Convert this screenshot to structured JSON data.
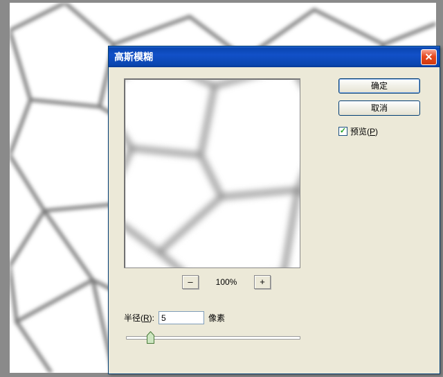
{
  "dialog": {
    "title": "高斯模糊",
    "ok_label": "确定",
    "cancel_label": "取消",
    "preview_label": "预览(",
    "preview_hotkey": "P",
    "preview_suffix": ")",
    "preview_checked": true,
    "zoom": {
      "minus": "–",
      "plus": "+",
      "percent": "100%"
    },
    "radius": {
      "label_prefix": "半径(",
      "hotkey": "R",
      "label_suffix": "):",
      "value": "5",
      "unit": "像素",
      "slider_pos_percent": 13
    }
  },
  "colors": {
    "titlebar": "#0a46b0",
    "panel": "#ece9d8",
    "border": "#003c74"
  }
}
